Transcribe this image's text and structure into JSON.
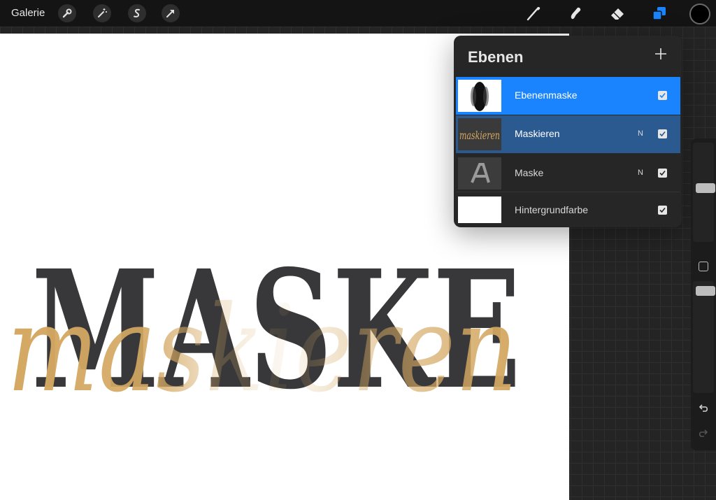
{
  "topbar": {
    "gallery_label": "Galerie",
    "left_tools": [
      "wrench-icon",
      "magic-wand-icon",
      "selection-s-icon",
      "transform-arrow-icon"
    ],
    "right_tools": [
      "brush-icon",
      "smudge-icon",
      "eraser-icon",
      "layers-icon"
    ],
    "active_tool": "layers-icon",
    "accent_color": "#1a84ff",
    "current_color": "#000000"
  },
  "canvas": {
    "background": "#ffffff",
    "headline_text": "MASKE",
    "headline_color": "#38383a",
    "script_text": "maskieren",
    "script_color": "#d4a862"
  },
  "layers_panel": {
    "title": "Ebenen",
    "add_icon": "plus-icon",
    "layers": [
      {
        "name": "Ebenenmaske",
        "blend": "",
        "visible": true,
        "state": "selected-mask",
        "bg": "#1a84ff"
      },
      {
        "name": "Maskieren",
        "blend": "N",
        "visible": true,
        "state": "selected",
        "bg": "#2b5a91"
      },
      {
        "name": "Maske",
        "blend": "N",
        "visible": true,
        "state": "normal",
        "bg": "#262626"
      },
      {
        "name": "Hintergrundfarbe",
        "blend": "",
        "visible": true,
        "state": "normal",
        "bg": "#262626"
      }
    ]
  },
  "sidebar": {
    "brush_size_level": 0.55,
    "opacity_level": 0.95,
    "undo_icon": "undo-icon",
    "redo_icon": "redo-icon"
  }
}
